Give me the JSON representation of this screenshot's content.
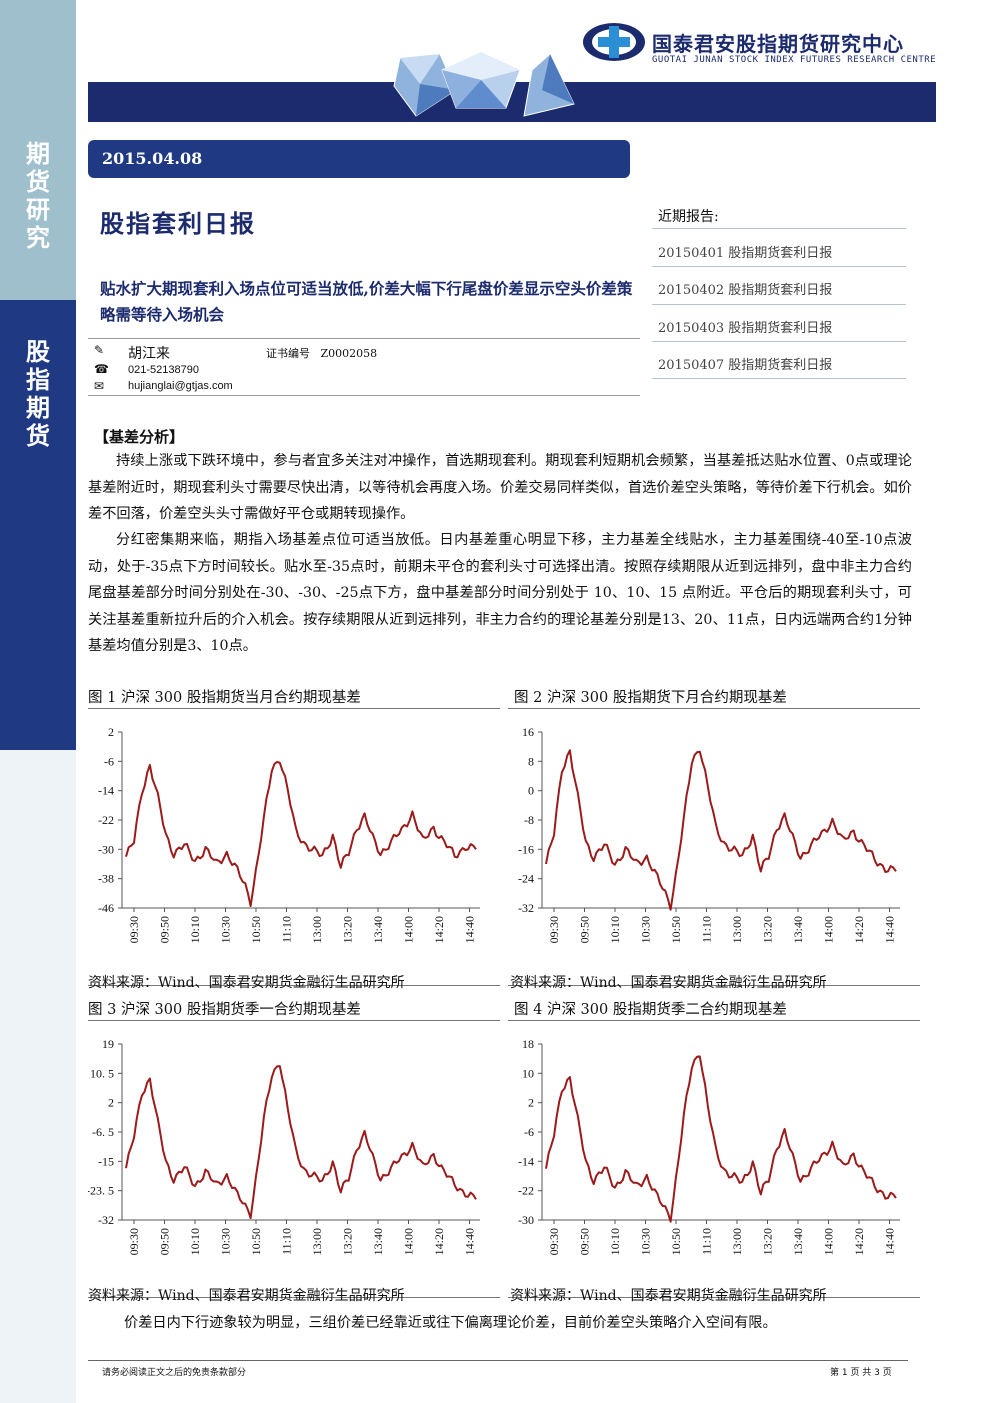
{
  "sidebar": {
    "top_label": "期货研究",
    "bottom_label": "股指期货"
  },
  "header": {
    "org_cn": "国泰君安股指期货研究中心",
    "org_en": "GUOTAI JUNAN STOCK INDEX FUTURES RESEARCH CENTRE",
    "brand_color": "#1c2b6e"
  },
  "date": "2015.04.08",
  "report_title": "股指套利日报",
  "headline": "贴水扩大期现套利入场点位可适当放低,价差大幅下行尾盘价差显示空头价差策略需等待入场机会",
  "author": {
    "name": "胡江来",
    "cert_label": "证书编号",
    "cert_no": "Z0002058",
    "phone": "021-52138790",
    "email": "hujianglai@gtjas.com"
  },
  "recent": {
    "title": "近期报告:",
    "items": [
      "20150401 股指期货套利日报",
      "20150402 股指期货套利日报",
      "20150403 股指期货套利日报",
      "20150407 股指期货套利日报"
    ]
  },
  "section_title": "【基差分析】",
  "paragraphs": [
    "持续上涨或下跌环境中，参与者宜多关注对冲操作，首选期现套利。期现套利短期机会频繁，当基差抵达贴水位置、0点或理论基差附近时，期现套利头寸需要尽快出清，以等待机会再度入场。价差交易同样类似，首选价差空头策略，等待价差下行机会。如价差不回落，价差空头头寸需做好平仓或期转现操作。",
    "分红密集期来临，期指入场基差点位可适当放低。日内基差重心明显下移，主力基差全线贴水，主力基差围绕-40至-10点波动，处于-35点下方时间较长。贴水至-35点时，前期未平仓的套利头寸可选择出清。按照存续期限从近到远排列，盘中非主力合约尾盘基差部分时间分别处在-30、-30、-25点下方，盘中基差部分时间分别处于 10、10、15 点附近。平仓后的期现套利头寸，可关注基差重新拉升后的介入机会。按存续期限从近到远排列，非主力合约的理论基差分别是13、20、11点，日内远端两合约1分钟基差均值分别是3、10点。"
  ],
  "closing": "价差日内下行迹象较为明显，三组价差已经靠近或往下偏离理论价差，目前价差空头策略介入空间有限。",
  "footer": {
    "left": "请务必阅读正文之后的免责条款部分",
    "right": "第 1 页 共 3 页"
  },
  "line_color": "#9b1b1b",
  "chart_data": [
    {
      "type": "line",
      "title": "图 1 沪深 300 股指期货当月合约期现基差",
      "source": "资料来源：Wind、国泰君安期货金融衍生品研究所",
      "yticks": [
        "2",
        "-6",
        "-14",
        "-22",
        "-30",
        "-38",
        "-46"
      ],
      "ylim": [
        -46,
        2
      ],
      "xticks": [
        "09:30",
        "09:50",
        "10:10",
        "10:30",
        "10:50",
        "11:10",
        "13:00",
        "13:20",
        "13:40",
        "14:00",
        "14:20",
        "14:40"
      ],
      "keypoints": [
        [
          0,
          -32
        ],
        [
          3,
          -28
        ],
        [
          6,
          -14
        ],
        [
          9,
          -7
        ],
        [
          12,
          -16
        ],
        [
          15,
          -26
        ],
        [
          18,
          -31
        ],
        [
          22,
          -29
        ],
        [
          26,
          -33
        ],
        [
          30,
          -30
        ],
        [
          34,
          -34
        ],
        [
          38,
          -31
        ],
        [
          42,
          -36
        ],
        [
          45,
          -40
        ],
        [
          47,
          -44
        ],
        [
          49,
          -36
        ],
        [
          52,
          -22
        ],
        [
          55,
          -8
        ],
        [
          58,
          -5
        ],
        [
          61,
          -14
        ],
        [
          64,
          -25
        ],
        [
          67,
          -28
        ],
        [
          70,
          -30
        ],
        [
          74,
          -32
        ],
        [
          78,
          -26
        ],
        [
          81,
          -35
        ],
        [
          84,
          -31
        ],
        [
          87,
          -24
        ],
        [
          90,
          -21
        ],
        [
          93,
          -27
        ],
        [
          96,
          -31
        ],
        [
          100,
          -28
        ],
        [
          104,
          -25
        ],
        [
          108,
          -20
        ],
        [
          112,
          -28
        ],
        [
          116,
          -24
        ],
        [
          120,
          -28
        ],
        [
          124,
          -32
        ],
        [
          128,
          -29
        ],
        [
          132,
          -30
        ]
      ]
    },
    {
      "type": "line",
      "title": "图 2 沪深 300 股指期货下月合约期现基差",
      "source": "资料来源：Wind、国泰君安期货金融衍生品研究所",
      "yticks": [
        "16",
        "8",
        "0",
        "-8",
        "-16",
        "-24",
        "-32"
      ],
      "ylim": [
        -32,
        16
      ],
      "xticks": [
        "09:30",
        "09:50",
        "10:10",
        "10:30",
        "10:50",
        "11:10",
        "13:00",
        "13:20",
        "13:40",
        "14:00",
        "14:20",
        "14:40"
      ],
      "keypoints": [
        [
          0,
          -20
        ],
        [
          3,
          -12
        ],
        [
          6,
          6
        ],
        [
          9,
          11
        ],
        [
          12,
          -2
        ],
        [
          15,
          -14
        ],
        [
          18,
          -18
        ],
        [
          22,
          -15
        ],
        [
          26,
          -20
        ],
        [
          30,
          -16
        ],
        [
          34,
          -20
        ],
        [
          38,
          -18
        ],
        [
          42,
          -24
        ],
        [
          45,
          -28
        ],
        [
          47,
          -31
        ],
        [
          49,
          -23
        ],
        [
          52,
          -8
        ],
        [
          55,
          8
        ],
        [
          58,
          12
        ],
        [
          61,
          1
        ],
        [
          64,
          -10
        ],
        [
          67,
          -14
        ],
        [
          70,
          -16
        ],
        [
          74,
          -18
        ],
        [
          78,
          -12
        ],
        [
          81,
          -22
        ],
        [
          84,
          -18
        ],
        [
          87,
          -10
        ],
        [
          90,
          -7
        ],
        [
          93,
          -13
        ],
        [
          96,
          -18
        ],
        [
          100,
          -15
        ],
        [
          104,
          -12
        ],
        [
          108,
          -8
        ],
        [
          112,
          -14
        ],
        [
          116,
          -11
        ],
        [
          120,
          -15
        ],
        [
          124,
          -19
        ],
        [
          128,
          -21
        ],
        [
          132,
          -22
        ]
      ]
    },
    {
      "type": "line",
      "title": "图 3 沪深 300 股指期货季一合约期现基差",
      "source": "资料来源：Wind、国泰君安期货金融衍生品研究所",
      "yticks": [
        "19",
        "10. 5",
        "2",
        "-6. 5",
        "-15",
        "-23. 5",
        "-32"
      ],
      "ylim": [
        -32,
        19
      ],
      "xticks": [
        "09:30",
        "09:50",
        "10:10",
        "10:30",
        "10:50",
        "11:10",
        "13:00",
        "13:20",
        "13:40",
        "14:00",
        "14:20",
        "14:40"
      ],
      "keypoints": [
        [
          0,
          -17
        ],
        [
          3,
          -8
        ],
        [
          6,
          5
        ],
        [
          9,
          9
        ],
        [
          12,
          -4
        ],
        [
          15,
          -15
        ],
        [
          18,
          -20
        ],
        [
          22,
          -17
        ],
        [
          26,
          -22
        ],
        [
          30,
          -18
        ],
        [
          34,
          -22
        ],
        [
          38,
          -19
        ],
        [
          42,
          -25
        ],
        [
          45,
          -28
        ],
        [
          47,
          -30
        ],
        [
          49,
          -20
        ],
        [
          52,
          -3
        ],
        [
          55,
          10
        ],
        [
          58,
          14
        ],
        [
          61,
          0
        ],
        [
          64,
          -12
        ],
        [
          67,
          -17
        ],
        [
          70,
          -19
        ],
        [
          74,
          -21
        ],
        [
          78,
          -15
        ],
        [
          81,
          -24
        ],
        [
          84,
          -20
        ],
        [
          87,
          -11
        ],
        [
          90,
          -7
        ],
        [
          93,
          -14
        ],
        [
          96,
          -20
        ],
        [
          100,
          -17
        ],
        [
          104,
          -14
        ],
        [
          108,
          -10
        ],
        [
          112,
          -17
        ],
        [
          116,
          -13
        ],
        [
          120,
          -18
        ],
        [
          124,
          -22
        ],
        [
          128,
          -24
        ],
        [
          132,
          -26
        ]
      ]
    },
    {
      "type": "line",
      "title": "图 4 沪深 300 股指期货季二合约期现基差",
      "source": "资料来源：Wind、国泰君安期货金融衍生品研究所",
      "yticks": [
        "18",
        "10",
        "2",
        "-6",
        "-14",
        "-22",
        "-30"
      ],
      "ylim": [
        -30,
        18
      ],
      "xticks": [
        "09:30",
        "09:50",
        "10:10",
        "10:30",
        "10:50",
        "11:10",
        "13:00",
        "13:20",
        "13:40",
        "14:00",
        "14:20",
        "14:40"
      ],
      "keypoints": [
        [
          0,
          -16
        ],
        [
          3,
          -7
        ],
        [
          6,
          6
        ],
        [
          9,
          9
        ],
        [
          12,
          -3
        ],
        [
          15,
          -14
        ],
        [
          18,
          -19
        ],
        [
          22,
          -16
        ],
        [
          26,
          -21
        ],
        [
          30,
          -17
        ],
        [
          34,
          -21
        ],
        [
          38,
          -18
        ],
        [
          42,
          -24
        ],
        [
          45,
          -27
        ],
        [
          47,
          -29
        ],
        [
          49,
          -19
        ],
        [
          52,
          -2
        ],
        [
          55,
          12
        ],
        [
          58,
          16
        ],
        [
          61,
          1
        ],
        [
          64,
          -11
        ],
        [
          67,
          -16
        ],
        [
          70,
          -18
        ],
        [
          74,
          -20
        ],
        [
          78,
          -14
        ],
        [
          81,
          -23
        ],
        [
          84,
          -19
        ],
        [
          87,
          -10
        ],
        [
          90,
          -6
        ],
        [
          93,
          -13
        ],
        [
          96,
          -19
        ],
        [
          100,
          -16
        ],
        [
          104,
          -13
        ],
        [
          108,
          -9
        ],
        [
          112,
          -16
        ],
        [
          116,
          -12
        ],
        [
          120,
          -17
        ],
        [
          124,
          -21
        ],
        [
          128,
          -23
        ],
        [
          132,
          -24
        ]
      ]
    }
  ]
}
